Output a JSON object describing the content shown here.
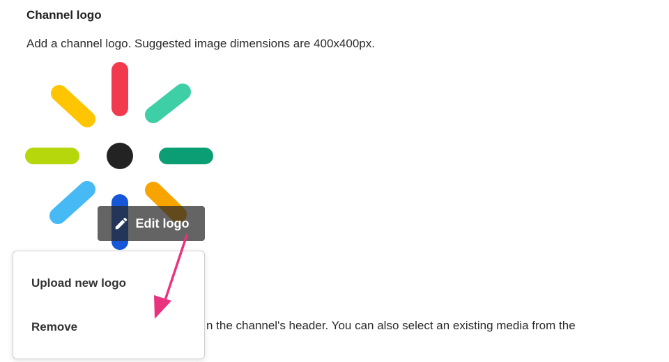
{
  "section": {
    "title": "Channel logo",
    "description": "Add a channel logo. Suggested image dimensions are 400x400px."
  },
  "logo": {
    "icon": "sunburst-logo",
    "colors": {
      "top": "#f23a4e",
      "top_right": "#3ecfa6",
      "right": "#0b9e74",
      "bottom_right": "#f7a300",
      "bottom": "#1657d8",
      "bottom_left": "#47b9f5",
      "left": "#b5d70b",
      "top_left": "#ffc500",
      "center": "#232323"
    }
  },
  "edit_button": {
    "label": "Edit logo",
    "icon": "pencil-icon"
  },
  "dropdown": {
    "items": [
      {
        "label": "Upload new logo"
      },
      {
        "label": "Remove"
      }
    ]
  },
  "background_text": "n the channel's header. You can also select an existing media from the",
  "annotation": {
    "arrow_color": "#e9337e"
  }
}
